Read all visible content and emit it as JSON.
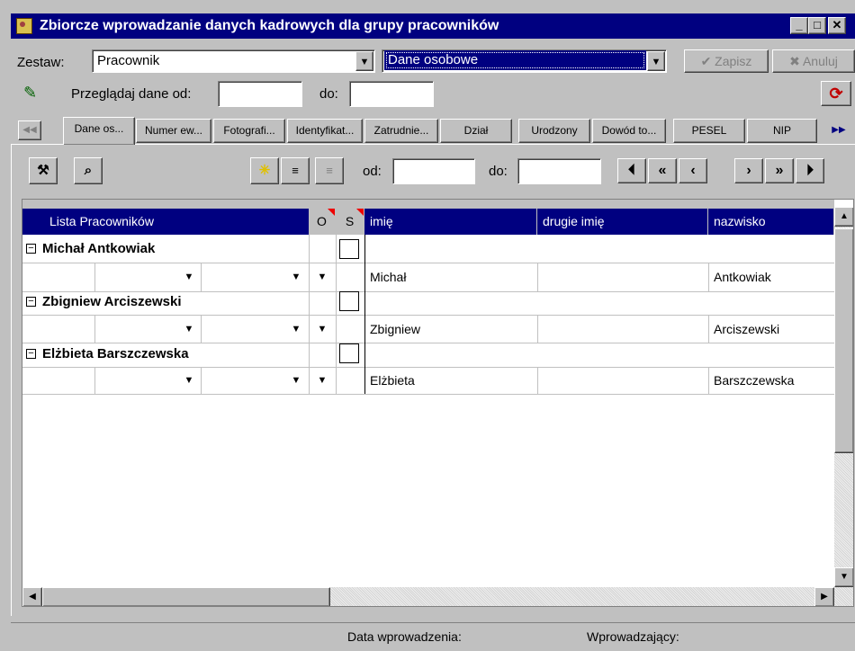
{
  "window": {
    "title": "Zbiorcze wprowadzanie danych kadrowych dla grupy pracowników",
    "min": "_",
    "max": "□",
    "close": "✕"
  },
  "zestaw": {
    "label": "Zestaw:",
    "value": "Pracownik",
    "second_value": "Dane osobowe"
  },
  "buttons": {
    "save": "✔ Zapisz",
    "cancel": "✖ Anuluj"
  },
  "browse": {
    "label": "Przeglądaj dane od:",
    "to_label": "do:",
    "from_value": "",
    "to_value": ""
  },
  "tabs": [
    "Dane os...",
    "Numer ew...",
    "Fotografi...",
    "Identyfikat...",
    "Zatrudnie...",
    "Dział",
    "Urodzony",
    "Dowód to...",
    "PESEL",
    "NIP"
  ],
  "toolbar": {
    "od_label": "od:",
    "do_label": "do:"
  },
  "grid": {
    "headers": {
      "list": "Lista Pracowników",
      "o": "O",
      "s": "S",
      "first": "imię",
      "middle": "drugie imię",
      "last": "nazwisko"
    },
    "employees": [
      {
        "group": "Michał Antkowiak",
        "first": "Michał",
        "middle": "",
        "last": "Antkowiak"
      },
      {
        "group": "Zbigniew Arciszewski",
        "first": "Zbigniew",
        "middle": "",
        "last": "Arciszewski"
      },
      {
        "group": "Elżbieta Barszczewska",
        "first": "Elżbieta",
        "middle": "",
        "last": "Barszczewska"
      }
    ]
  },
  "statusbar": {
    "date_label": "Data wprowadzenia:",
    "user_label": "Wprowadzający:"
  }
}
